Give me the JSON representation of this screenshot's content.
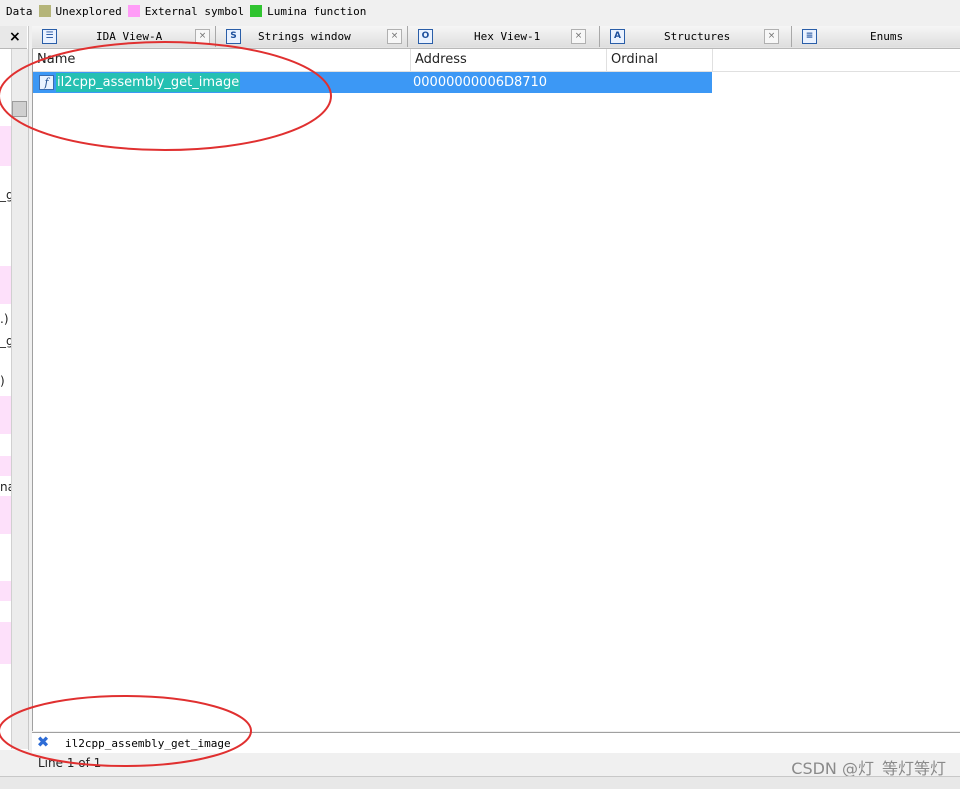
{
  "legend": [
    {
      "label": "Data",
      "color": ""
    },
    {
      "label": "Unexplored",
      "color": "#b5b57a"
    },
    {
      "label": "External symbol",
      "color": "#ff9cf7"
    },
    {
      "label": "Lumina function",
      "color": "#30c430"
    }
  ],
  "left_panel": {
    "close_label": "×",
    "fragments": [
      "_g",
      ".)",
      "_g",
      ")",
      "na"
    ]
  },
  "tabs": [
    {
      "label": "IDA View-A",
      "icon": "ida-view-icon",
      "icon_glyph": "☰",
      "close": "×"
    },
    {
      "label": "Strings window",
      "icon": "strings-icon",
      "icon_glyph": "S",
      "close": "×"
    },
    {
      "label": "Hex View-1",
      "icon": "hex-view-icon",
      "icon_glyph": "O",
      "close": "×"
    },
    {
      "label": "Structures",
      "icon": "structures-icon",
      "icon_glyph": "A",
      "close": "×"
    },
    {
      "label": "Enums",
      "icon": "enums-icon",
      "icon_glyph": "≡",
      "close": ""
    }
  ],
  "columns": [
    "Name",
    "Address",
    "Ordinal"
  ],
  "rows": [
    {
      "icon_glyph": "f",
      "name": "il2cpp_assembly_get_image",
      "address": "00000000006D8710",
      "ordinal": ""
    }
  ],
  "search": {
    "close_glyph": "✖",
    "value": "il2cpp_assembly_get_image"
  },
  "status": {
    "line": "Line 1 of 1",
    "watermark": "CSDN @灯_等灯等灯"
  },
  "colors": {
    "selection": "#3c98f5",
    "match_highlight": "#25c0b2",
    "annotation": "#e03030"
  }
}
